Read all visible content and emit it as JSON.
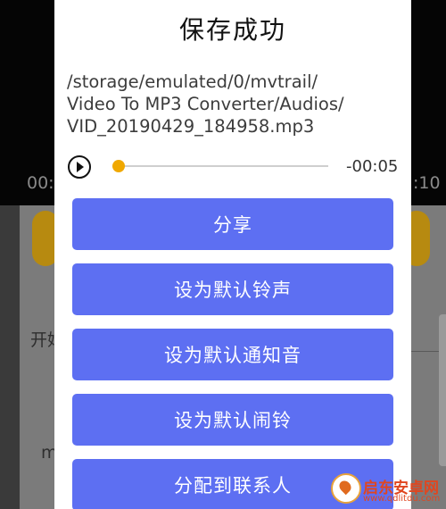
{
  "background": {
    "time_left": "00:",
    "time_right": ":10",
    "label_start": "开始",
    "label_m": "m"
  },
  "dialog": {
    "title": "保存成功",
    "path_lines": [
      "/storage/emulated/0/mvtrail/",
      "Video To MP3 Converter/Audios/",
      "VID_20190429_184958.mp3"
    ],
    "player": {
      "remaining_time": "-00:05",
      "progress": 0.0,
      "icon": "play-icon"
    },
    "buttons": [
      {
        "label": "分享"
      },
      {
        "label": "设为默认铃声"
      },
      {
        "label": "设为默认通知音"
      },
      {
        "label": "设为默认闹铃"
      },
      {
        "label": "分配到联系人"
      }
    ]
  },
  "watermark": {
    "name": "启东安卓网",
    "url": "www.qdlitdu.com"
  },
  "colors": {
    "button": "#5d6ff2",
    "thumb": "#f0a800",
    "accent_handle": "#b78a10"
  }
}
